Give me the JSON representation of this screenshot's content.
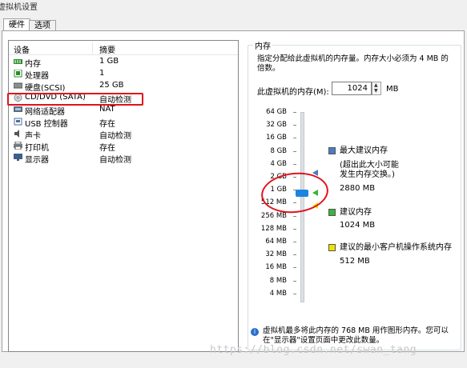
{
  "window": {
    "title": "虚拟机设置"
  },
  "tabs": [
    {
      "label": "硬件",
      "active": true
    },
    {
      "label": "选项",
      "active": false
    }
  ],
  "device_list": {
    "headers": {
      "device": "设备",
      "summary": "摘要"
    },
    "items": [
      {
        "icon": "memory-icon",
        "name": "内存",
        "summary": "1 GB"
      },
      {
        "icon": "processor-icon",
        "name": "处理器",
        "summary": "1"
      },
      {
        "icon": "harddisk-icon",
        "name": "硬盘(SCSI)",
        "summary": "25 GB"
      },
      {
        "icon": "cd-dvd-icon",
        "name": "CD/DVD (SATA)",
        "summary": "自动检测"
      },
      {
        "icon": "network-adapter-icon",
        "name": "网络适配器",
        "summary": "NAT"
      },
      {
        "icon": "usb-icon",
        "name": "USB 控制器",
        "summary": "存在"
      },
      {
        "icon": "sound-card-icon",
        "name": "声卡",
        "summary": "自动检测"
      },
      {
        "icon": "printer-icon",
        "name": "打印机",
        "summary": "存在"
      },
      {
        "icon": "display-icon",
        "name": "显示器",
        "summary": "自动检测"
      }
    ]
  },
  "memory": {
    "group_title": "内存",
    "description": "指定分配给此虚拟机的内存量。内存大小必须为 4 MB 的倍数。",
    "field_label": "此虚拟机的内存(M):",
    "value": "1024",
    "unit": "MB",
    "scale_labels": [
      "64 GB",
      "32 GB",
      "16 GB",
      "8 GB",
      "4 GB",
      "2 GB",
      "1 GB",
      "512 MB",
      "256 MB",
      "128 MB",
      "64 MB",
      "32 MB",
      "16 MB",
      "8 MB",
      "4 MB"
    ],
    "legend": {
      "max": {
        "title": "最大建议内存",
        "note_line1": "(超出此大小可能",
        "note_line2": "发生内存交换。)",
        "value": "2880 MB",
        "color": "#4a7cbf"
      },
      "recommended": {
        "title": "建议内存",
        "value": "1024 MB",
        "color": "#3cb43c"
      },
      "min_guest": {
        "title": "建议的最小客户机操作系统内存",
        "value": "512 MB",
        "color": "#f2e000"
      }
    },
    "info": "虚拟机最多将此内存的 768 MB 用作图形内存。您可以在\"显示器\"设置页面中更改此数量。"
  },
  "watermark": "https://blog.csdn.net/swan_tang",
  "colors": {
    "accent": "#1b84de",
    "annotation": "#e0141c"
  }
}
